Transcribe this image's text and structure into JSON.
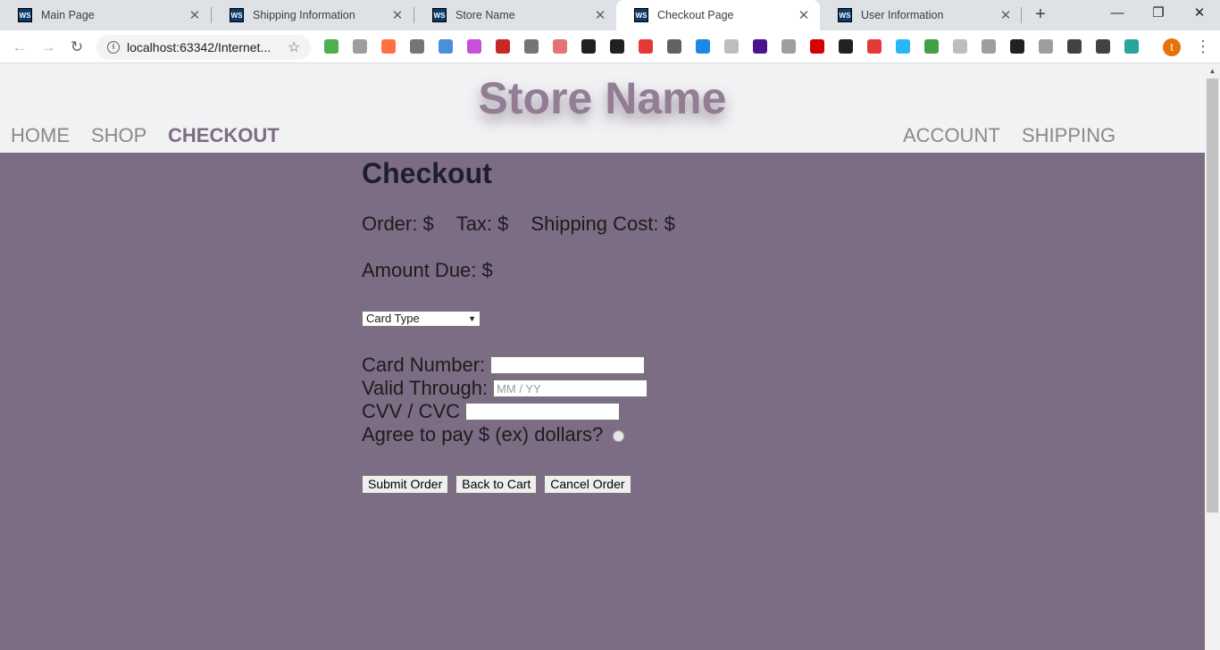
{
  "browser": {
    "tabs": [
      {
        "title": "Main Page",
        "icon": "webstorm-icon"
      },
      {
        "title": "Shipping Information",
        "icon": "webstorm-icon"
      },
      {
        "title": "Store Name",
        "icon": "webstorm-icon"
      },
      {
        "title": "Checkout Page",
        "icon": "webstorm-icon",
        "active": true
      },
      {
        "title": "User Information",
        "icon": "webstorm-icon"
      }
    ],
    "tab_close": "✕",
    "new_tab": "+",
    "window_controls": {
      "minimize": "—",
      "restore": "❐",
      "close": "✕"
    },
    "url": "localhost:63342/Internet...",
    "profile_initial": "t",
    "extension_colors": [
      "#4caf50",
      "#9e9e9e",
      "#ff7043",
      "#757575",
      "#4a90d9",
      "#c84fd8",
      "#c62828",
      "#757575",
      "#e57373",
      "#212121",
      "#212121",
      "#e53935",
      "#616161",
      "#1e88e5",
      "#bdbdbd",
      "#4a148c",
      "#9e9e9e",
      "#d50000",
      "#212121",
      "#e53935",
      "#29b6f6",
      "#43a047",
      "#bdbdbd",
      "#9e9e9e",
      "#212121",
      "#9e9e9e",
      "#424242",
      "#424242",
      "#26a69a"
    ]
  },
  "header": {
    "store_name": "Store Name",
    "nav_left": [
      "HOME",
      "SHOP",
      "CHECKOUT"
    ],
    "nav_right": [
      "ACCOUNT",
      "SHIPPING"
    ],
    "current": "CHECKOUT"
  },
  "checkout": {
    "title": "Checkout",
    "order_label": "Order: $",
    "tax_label": "Tax: $",
    "shipping_label": "Shipping Cost: $",
    "amount_due_label": "Amount Due: $",
    "card_type_selected": "Card Type",
    "card_number_label": "Card Number:",
    "card_number_value": "",
    "valid_through_label": "Valid Through:",
    "valid_through_placeholder": "MM / YY",
    "cvv_label": "CVV / CVC",
    "cvv_value": "",
    "agree_label": "Agree to pay $ (ex) dollars?",
    "agree_checked": false,
    "buttons": {
      "submit": "Submit Order",
      "back": "Back to Cart",
      "cancel": "Cancel Order"
    }
  },
  "colors": {
    "page_background": "#7d6d84",
    "header_background": "#f1f2f4",
    "brand": "#937d94",
    "nav_text": "#8a8a8a"
  }
}
